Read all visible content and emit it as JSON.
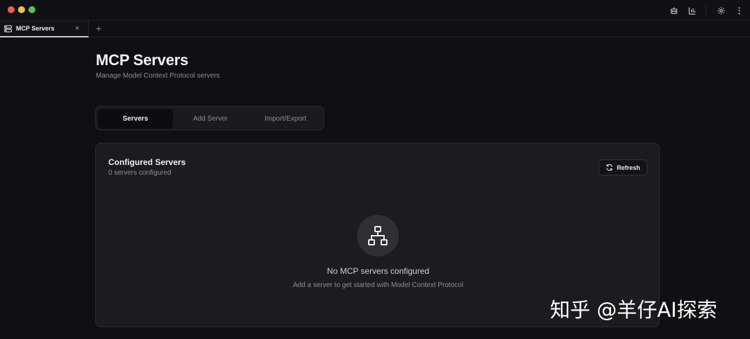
{
  "tab": {
    "label": "MCP Servers",
    "close": "×",
    "add": "+"
  },
  "page": {
    "title": "MCP Servers",
    "subtitle": "Manage Model Context Protocol servers"
  },
  "segments": [
    "Servers",
    "Add Server",
    "Import/Export"
  ],
  "card": {
    "title": "Configured Servers",
    "subtitle": "0 servers configured",
    "refresh_label": "Refresh",
    "empty_title": "No MCP servers configured",
    "empty_subtitle": "Add a server to get started with Model Context Protocol"
  },
  "watermark": "知乎 @羊仔AI探索",
  "icons": {
    "titlebar": [
      "bot-icon",
      "bar-chart-icon",
      "gear-icon",
      "more-vertical-icon"
    ],
    "tab": "server-icon",
    "refresh": "refresh-icon",
    "empty": "network-icon"
  },
  "colors": {
    "background": "#0f1013",
    "card": "#1b1c20",
    "traffic_red": "#ee5a52",
    "traffic_yellow": "#f5be4f",
    "traffic_green": "#5ac05a"
  }
}
